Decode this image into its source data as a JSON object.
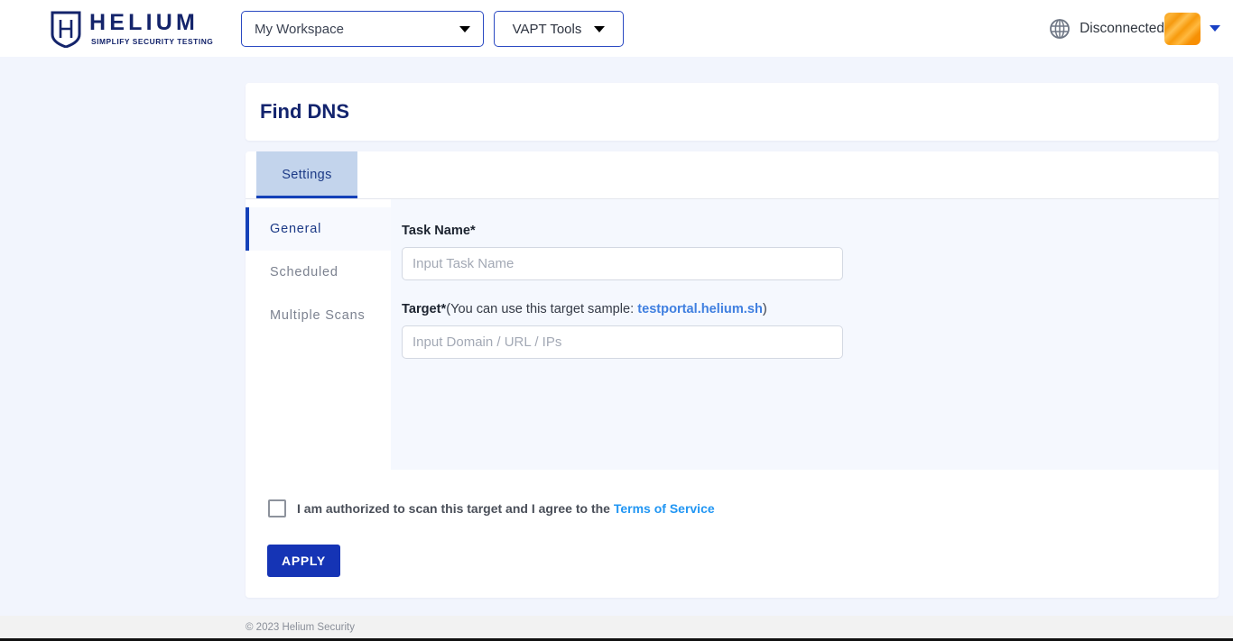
{
  "header": {
    "logo": {
      "icon": "shield-h-logo-icon",
      "main": "HELIUM",
      "tagline": "SIMPLIFY SECURITY TESTING"
    },
    "workspace": {
      "selected": "My Workspace",
      "caret_icon": "chevron-down-icon"
    },
    "vapt_tools": {
      "label": "VAPT Tools",
      "caret_icon": "chevron-down-icon"
    },
    "connection": {
      "icon": "globe-icon",
      "status": "Disconnected"
    },
    "avatar": {
      "name": "user-avatar",
      "color": "#f6a21a",
      "caret_icon": "chevron-down-icon"
    }
  },
  "page": {
    "title": "Find DNS"
  },
  "tabs": [
    {
      "label": "Settings",
      "active": true
    }
  ],
  "sidenav": {
    "items": [
      {
        "label": "General",
        "active": true
      },
      {
        "label": "Scheduled",
        "active": false
      },
      {
        "label": "Multiple Scans",
        "active": false
      }
    ]
  },
  "form": {
    "task_name": {
      "label": "Task Name*",
      "placeholder": "Input Task Name",
      "value": ""
    },
    "target": {
      "label": "Target*",
      "hint_prefix": "(You can use this target sample: ",
      "sample_link": "testportal.helium.sh",
      "hint_suffix": ")",
      "placeholder": "Input Domain / URL / IPs",
      "value": ""
    }
  },
  "consent": {
    "checked": false,
    "text": "I am authorized to scan this target and I agree to the",
    "link": "Terms of Service"
  },
  "actions": {
    "apply_label": "APPLY",
    "apply_color": "#1534b5"
  },
  "footer": {
    "copyright": "© 2023 Helium Security"
  }
}
